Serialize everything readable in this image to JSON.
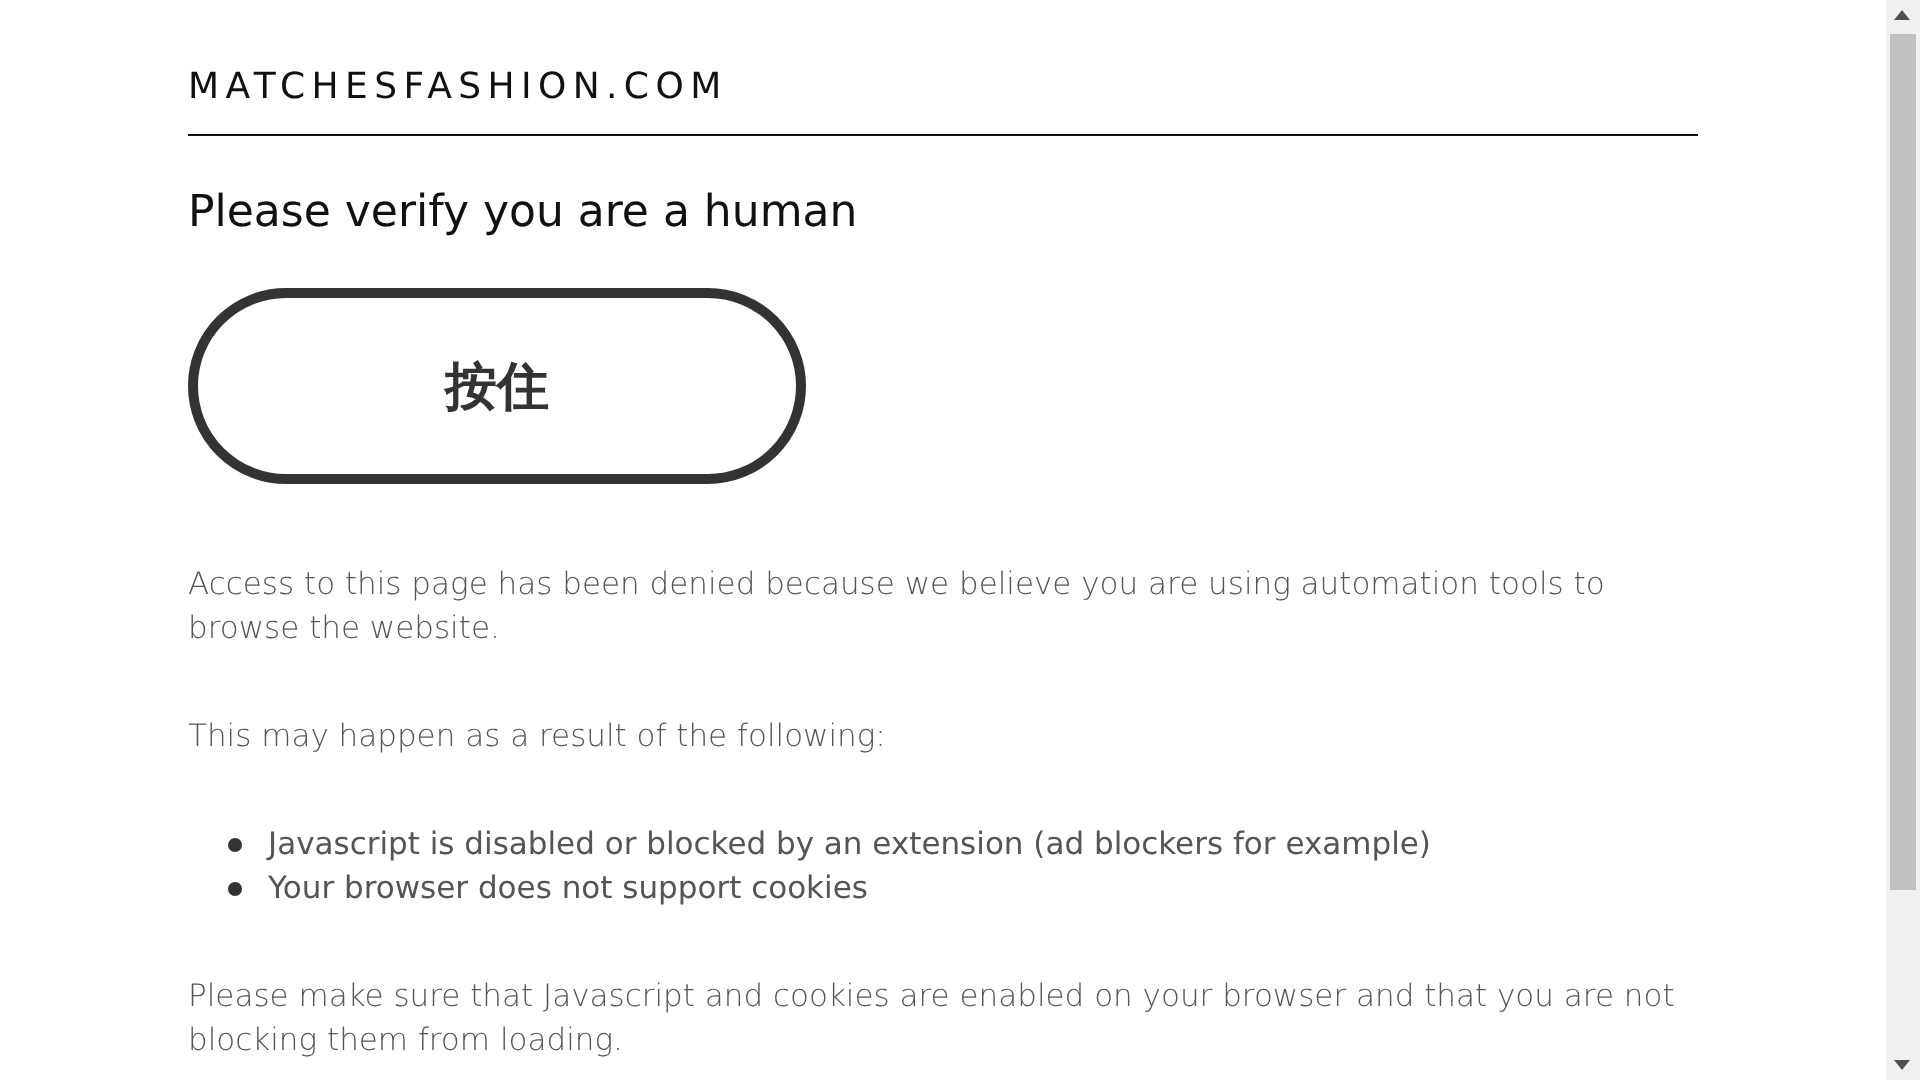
{
  "logo": "MATCHESFASHION.COM",
  "heading": "Please verify you are a human",
  "hold_button": "按住",
  "intro": "Access to this page has been denied because we believe you are using automation tools to browse the website.",
  "reasons_title": "This may happen as a result of the following:",
  "reasons": [
    "Javascript is disabled or blocked by an extension (ad blockers for example)",
    "Your browser does not support cookies"
  ],
  "footer": "Please make sure that Javascript and cookies are enabled on your browser and that you are not blocking them from loading."
}
